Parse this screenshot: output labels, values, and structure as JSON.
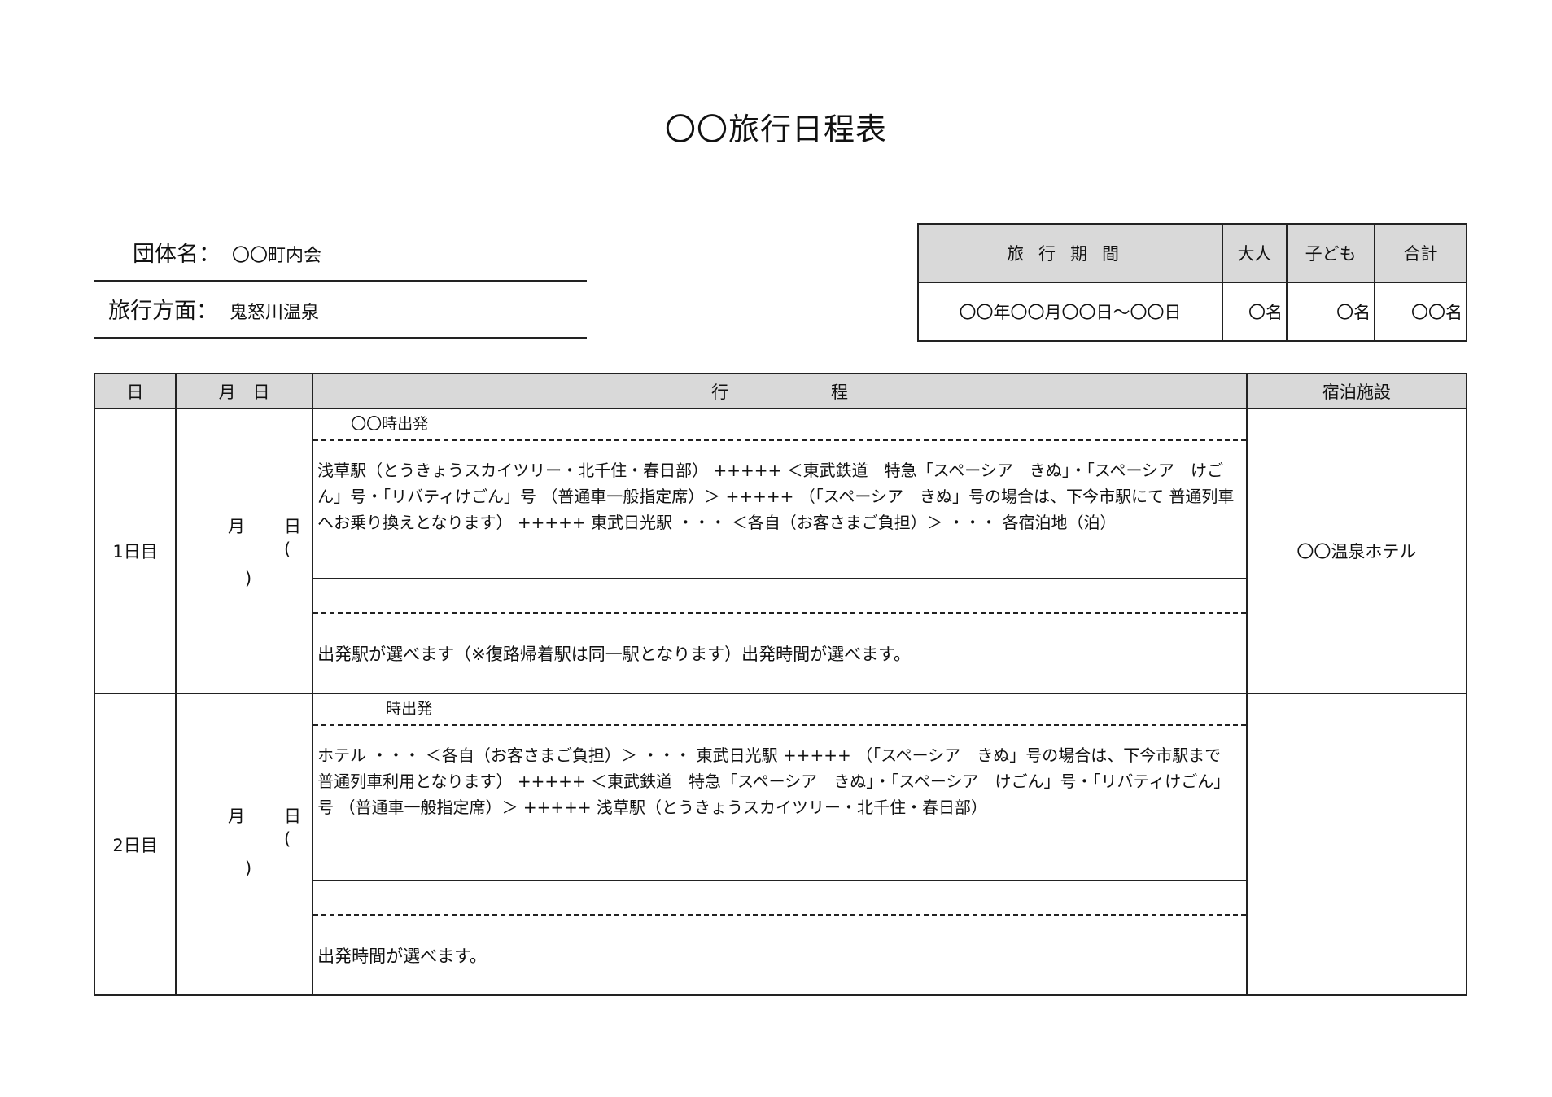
{
  "title": "〇〇旅行日程表",
  "info": {
    "group_label": "団体名：",
    "group_value": "〇〇町内会",
    "destination_label": "旅行方面：",
    "destination_value": "鬼怒川温泉"
  },
  "summary": {
    "headers": [
      "旅行期間",
      "大人",
      "子ども",
      "合計"
    ],
    "period": "〇〇年〇〇月〇〇日～〇〇日",
    "adults": "〇名",
    "children": "〇名",
    "total": "〇〇名"
  },
  "schedule": {
    "headers": {
      "day": "日",
      "date": "月　日",
      "route": "行　　　　　　程",
      "hotel": "宿泊施設"
    },
    "rows": [
      {
        "day": "1日目",
        "month_label": "月",
        "day_label": "日",
        "open_paren": "(",
        "close_paren": ")",
        "departure": "〇〇時出発",
        "route": "浅草駅（とうきょうスカイツリー・北千住・春日部） +++++ ＜東武鉄道　特急「スペーシア　きぬ」・「スペーシア　けごん」号・「リバティけごん」号 （普通車一般指定席）＞ +++++ （「スペーシア　きぬ」号の場合は、下今市駅にて 普通列車へお乗り換えとなります） +++++ 東武日光駅 ・・・ ＜各自（お客さまご負担）＞ ・・・ 各宿泊地（泊）",
        "note": "出発駅が選べます（※復路帰着駅は同一駅となります）出発時間が選べます。",
        "hotel": "〇〇温泉ホテル"
      },
      {
        "day": "2日目",
        "month_label": "月",
        "day_label": "日",
        "open_paren": "(",
        "close_paren": ")",
        "departure": "時出発",
        "route": "ホテル ・・・ ＜各自（お客さまご負担）＞ ・・・ 東武日光駅 +++++ （「スペーシア　きぬ」号の場合は、下今市駅まで 普通列車利用となります） +++++ ＜東武鉄道　特急「スペーシア　きぬ」・「スペーシア　けごん」号・「リバティけごん」号 （普通車一般指定席）＞ +++++ 浅草駅（とうきょうスカイツリー・北千住・春日部）",
        "note": "出発時間が選べます。",
        "hotel": ""
      }
    ]
  }
}
